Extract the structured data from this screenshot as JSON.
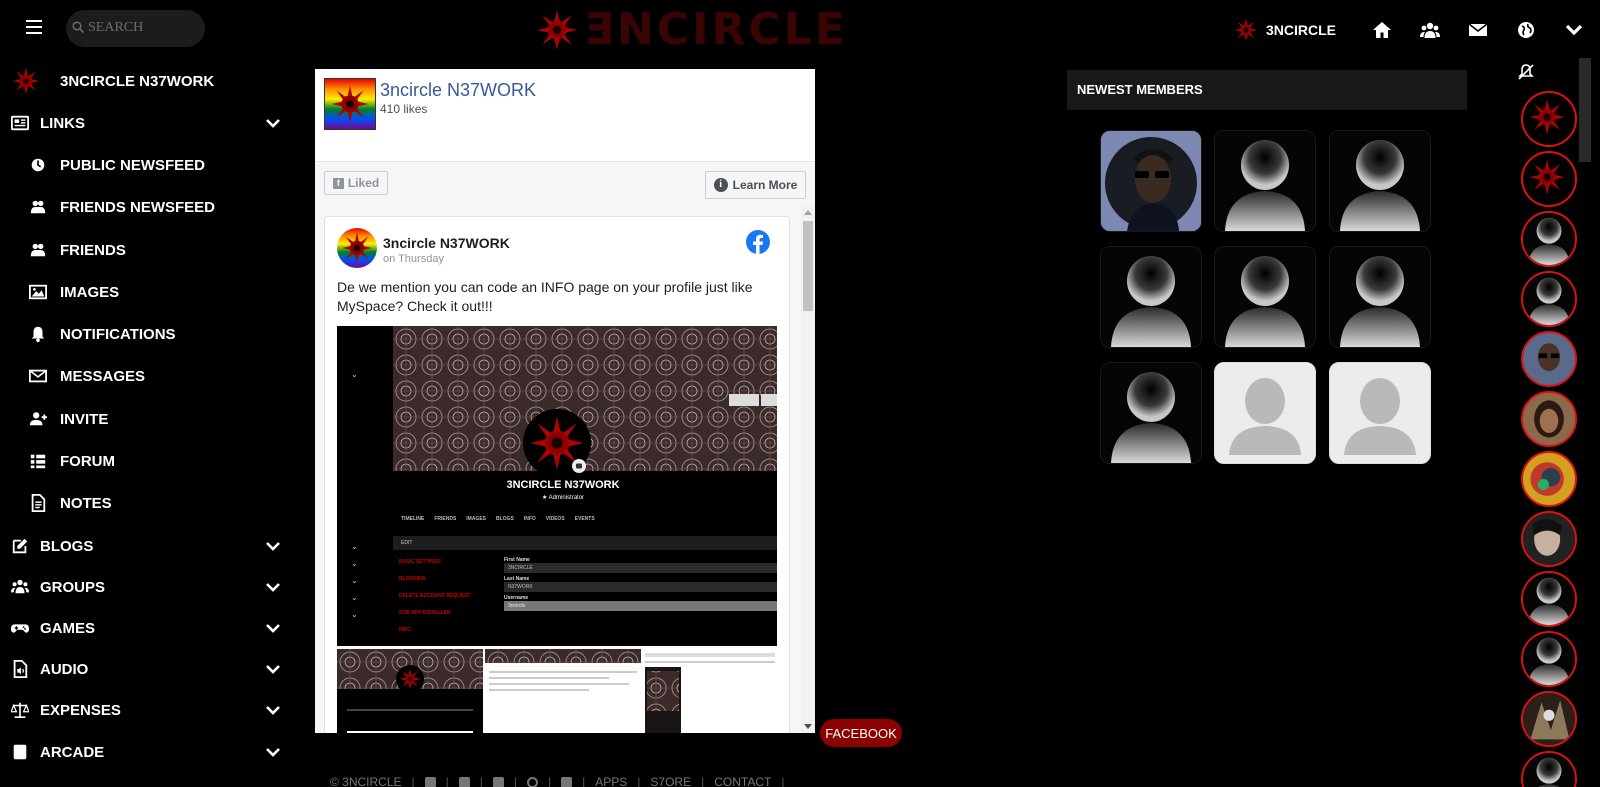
{
  "topbar": {
    "search_placeholder": "SEARCH",
    "logo_text": "ƎNCIRCLE",
    "brand_label": "3NCIRCLE",
    "icons": [
      "home-icon",
      "groups-icon",
      "mail-icon",
      "globe-icon",
      "chevron-down-icon"
    ]
  },
  "sidebar": {
    "site_name": "3NCIRCLE N37WORK",
    "items": [
      {
        "label": "LINKS",
        "icon": "newspaper-icon",
        "expandable": true
      },
      {
        "label": "PUBLIC NEWSFEED",
        "icon": "clock-icon"
      },
      {
        "label": "FRIENDS NEWSFEED",
        "icon": "users-icon"
      },
      {
        "label": "FRIENDS",
        "icon": "users-icon"
      },
      {
        "label": "IMAGES",
        "icon": "image-icon"
      },
      {
        "label": "NOTIFICATIONS",
        "icon": "bell-icon"
      },
      {
        "label": "MESSAGES",
        "icon": "envelope-icon"
      },
      {
        "label": "INVITE",
        "icon": "user-plus-icon"
      },
      {
        "label": "FORUM",
        "icon": "grid-icon"
      },
      {
        "label": "NOTES",
        "icon": "note-icon"
      },
      {
        "label": "BLOGS",
        "icon": "edit-icon",
        "expandable": true
      },
      {
        "label": "GROUPS",
        "icon": "users-icon",
        "expandable": true
      },
      {
        "label": "GAMES",
        "icon": "gamepad-icon",
        "expandable": true
      },
      {
        "label": "AUDIO",
        "icon": "audio-file-icon",
        "expandable": true
      },
      {
        "label": "EXPENSES",
        "icon": "balance-icon",
        "expandable": true
      },
      {
        "label": "ARCADE",
        "icon": "arcade-icon",
        "expandable": true
      }
    ]
  },
  "facebook_widget": {
    "page_name": "3ncircle N37WORK",
    "likes": "410 likes",
    "liked_label": "Liked",
    "learn_more_label": "Learn More",
    "post": {
      "author": "3ncircle N37WORK",
      "date": "on Thursday",
      "text": "De we mention you can code an INFO page on your profile just like MySpace? Check it out!!!",
      "embedded_profile": {
        "name": "3NCIRCLE N37WORK",
        "role": "★ Administrator",
        "tabs": [
          "TIMELINE",
          "FRIENDS",
          "IMAGES",
          "BLOGS",
          "INFO",
          "VIDEOS",
          "EVENTS"
        ],
        "edit_label": "EDIT",
        "menu": [
          "BASIC SETTINGS",
          "BLOCKING",
          "DELETE ACCOUNT REQUEST",
          "SITE APP INSTALLER",
          "INFO"
        ],
        "fields": [
          {
            "label": "First Name",
            "value": "3NCIRCLE"
          },
          {
            "label": "Last Name",
            "value": "N37WORK"
          },
          {
            "label": "Username",
            "value": "3ncircle"
          }
        ]
      }
    },
    "tag_label": "FACEBOOK"
  },
  "footer": {
    "copyright": "© 3NCIRCLE",
    "links": [
      "APPS",
      "S7ORE",
      "CONTACT"
    ],
    "social_icons": [
      "facebook-icon",
      "twitter-icon",
      "tumblr-icon",
      "google-icon",
      "youtube-icon"
    ]
  },
  "newest_members": {
    "title": "NEWEST MEMBERS",
    "members": [
      {
        "avatar": "photo"
      },
      {
        "avatar": "default-dark"
      },
      {
        "avatar": "default-dark"
      },
      {
        "avatar": "default-dark"
      },
      {
        "avatar": "default-dark"
      },
      {
        "avatar": "default-dark"
      },
      {
        "avatar": "default-dark"
      },
      {
        "avatar": "default-light"
      },
      {
        "avatar": "default-light"
      }
    ]
  },
  "right_rail": {
    "icon": "bell-slash-icon",
    "avatars": [
      "logo",
      "logo",
      "default",
      "default",
      "photo",
      "photo",
      "photo",
      "photo",
      "default",
      "default",
      "photo",
      "default"
    ]
  },
  "colors": {
    "accent_red": "#cc1111",
    "dark_red": "#8b0000",
    "facebook_blue": "#1877f2",
    "link_blue": "#385898"
  }
}
